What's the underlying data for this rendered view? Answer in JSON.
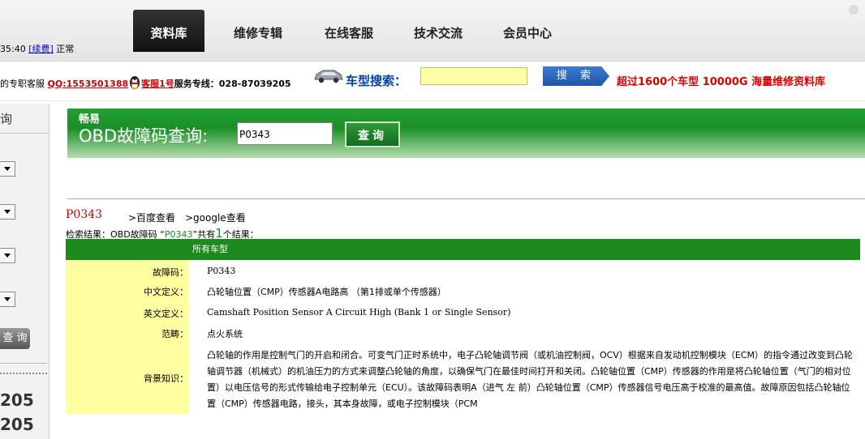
{
  "topbar": {
    "status": {
      "time": "35:40",
      "renew": "[续费]",
      "state": "正常"
    },
    "nav": [
      "资料库",
      "维修专辑",
      "在线客服",
      "技术交流",
      "会员中心"
    ]
  },
  "bar2": {
    "service_prefix": "的专职客服",
    "qq": "QQ:1553501388",
    "kefu": "客服1号",
    "hotline_label": "服务专线：",
    "hotline": "028-87039205",
    "search_label": "车型搜索：",
    "search_value": "",
    "search_button": "搜 索",
    "slogan": "超过1600个车型  10000G 海量维修资料库"
  },
  "sidebar": {
    "title": "询",
    "button": "查 询",
    "numbers": [
      "205",
      "205"
    ]
  },
  "banner": {
    "brand": "畅易",
    "title": "OBD故障码查询:",
    "input_value": "P0343",
    "button": "查询"
  },
  "result": {
    "code": "P0343",
    "baidu": ">百度查看",
    "google": ">google查看",
    "summary_prefix": "检索结果：OBD故障码 “",
    "summary_code": "P0343",
    "summary_mid": "”共有",
    "summary_count": "1",
    "summary_suffix": "个结果：",
    "category": "所有车型",
    "rows": [
      {
        "label": "故障码：",
        "value": "P0343"
      },
      {
        "label": "中文定义：",
        "value": "凸轮轴位置（CMP）传感器A电路高 （第1排或单个传感器）"
      },
      {
        "label": "英文定义：",
        "value": "Camshaft Position Sensor A Circuit High (Bank 1 or Single Sensor)"
      },
      {
        "label": "范畴：",
        "value": "点火系统"
      },
      {
        "label": "背景知识：",
        "value": "凸轮轴的作用是控制气门的开启和闭合。可变气门正时系统中，电子凸轮轴调节阀（或机油控制阀，OCV）根据来自发动机控制模块（ECM）的指令通过改变到凸轮轴调节器（机械式）的机油压力的方式来调整凸轮轴的角度，以确保气门在最佳时间打开和关闭。凸轮轴位置（CMP）传感器的作用是将凸轮轴位置（气门的相对位置）以电压信号的形式传输给电子控制单元（ECU）。该故障码表明A（进气 左 前）凸轮轴位置（CMP）传感器信号电压高于校准的最高值。故障原因包括凸轮轴位置（CMP）传感器电路，接头，其本身故障，或电子控制模块（PCM"
      }
    ]
  }
}
